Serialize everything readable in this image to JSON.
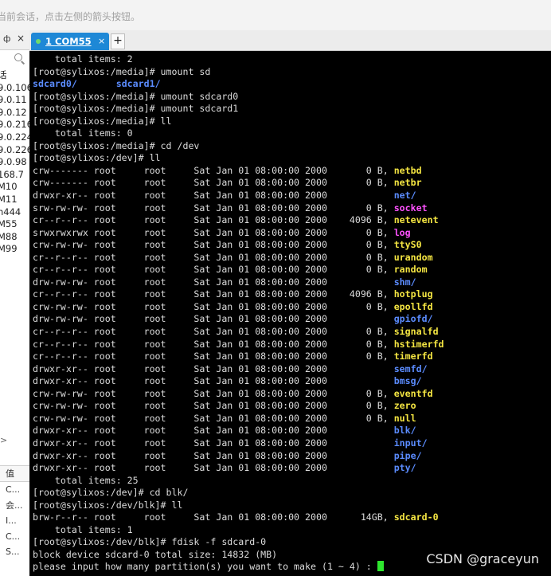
{
  "hint_bar": {
    "text": "当前会话，点击左侧的箭头按钮。"
  },
  "session_panel": {
    "pin_label": "ф",
    "close_label": "×",
    "items": [
      "话",
      "9.0.106",
      "9.0.11",
      "9.0.12",
      "9.0.216",
      "9.0.224",
      "9.0.226",
      "9.0.98",
      "168.7",
      "M10",
      "M11",
      "n444",
      "M55",
      "M88",
      "M99"
    ],
    "arrow_label": ">",
    "bottom_header": "值",
    "bottom_items": [
      "C...",
      "会...",
      "I...",
      "C...",
      "S..."
    ]
  },
  "tab_bar": {
    "tab_label": "1 COM55",
    "tab_close": "×",
    "new_tab": "+"
  },
  "terminal": {
    "cursor_color": "#2ee62e",
    "lines": [
      [
        {
          "t": "    total items: 2"
        }
      ],
      [
        {
          "t": "[root@sylixos:/media]# umount sd"
        }
      ],
      [
        {
          "t": "sdcard0/",
          "c": "b"
        },
        {
          "t": "       "
        },
        {
          "t": "sdcard1/",
          "c": "b"
        }
      ],
      [
        {
          "t": "[root@sylixos:/media]# umount sdcard0"
        }
      ],
      [
        {
          "t": "[root@sylixos:/media]# umount sdcard1"
        }
      ],
      [
        {
          "t": "[root@sylixos:/media]# ll"
        }
      ],
      [
        {
          "t": "    total items: 0"
        }
      ],
      [
        {
          "t": "[root@sylixos:/media]# cd /dev"
        }
      ],
      [
        {
          "t": "[root@sylixos:/dev]# ll"
        }
      ],
      [
        {
          "t": "crw------- root     root     Sat Jan 01 08:00:00 2000       0 B, "
        },
        {
          "t": "netbd",
          "c": "y"
        }
      ],
      [
        {
          "t": "crw------- root     root     Sat Jan 01 08:00:00 2000       0 B, "
        },
        {
          "t": "netbr",
          "c": "y"
        }
      ],
      [
        {
          "t": "drwxr-xr-- root     root     Sat Jan 01 08:00:00 2000            "
        },
        {
          "t": "net/",
          "c": "b"
        }
      ],
      [
        {
          "t": "srw-rw-rw- root     root     Sat Jan 01 08:00:00 2000       0 B, "
        },
        {
          "t": "socket",
          "c": "m"
        }
      ],
      [
        {
          "t": "cr--r--r-- root     root     Sat Jan 01 08:00:00 2000    4096 B, "
        },
        {
          "t": "netevent",
          "c": "y"
        }
      ],
      [
        {
          "t": "srwxrwxrwx root     root     Sat Jan 01 08:00:00 2000       0 B, "
        },
        {
          "t": "log",
          "c": "m"
        }
      ],
      [
        {
          "t": "crw-rw-rw- root     root     Sat Jan 01 08:00:00 2000       0 B, "
        },
        {
          "t": "ttyS0",
          "c": "y"
        }
      ],
      [
        {
          "t": "cr--r--r-- root     root     Sat Jan 01 08:00:00 2000       0 B, "
        },
        {
          "t": "urandom",
          "c": "y"
        }
      ],
      [
        {
          "t": "cr--r--r-- root     root     Sat Jan 01 08:00:00 2000       0 B, "
        },
        {
          "t": "random",
          "c": "y"
        }
      ],
      [
        {
          "t": "drw-rw-rw- root     root     Sat Jan 01 08:00:00 2000            "
        },
        {
          "t": "shm/",
          "c": "b"
        }
      ],
      [
        {
          "t": "cr--r--r-- root     root     Sat Jan 01 08:00:00 2000    4096 B, "
        },
        {
          "t": "hotplug",
          "c": "y"
        }
      ],
      [
        {
          "t": "crw-rw-rw- root     root     Sat Jan 01 08:00:00 2000       0 B, "
        },
        {
          "t": "epollfd",
          "c": "y"
        }
      ],
      [
        {
          "t": "drw-rw-rw- root     root     Sat Jan 01 08:00:00 2000            "
        },
        {
          "t": "gpiofd/",
          "c": "b"
        }
      ],
      [
        {
          "t": "cr--r--r-- root     root     Sat Jan 01 08:00:00 2000       0 B, "
        },
        {
          "t": "signalfd",
          "c": "y"
        }
      ],
      [
        {
          "t": "cr--r--r-- root     root     Sat Jan 01 08:00:00 2000       0 B, "
        },
        {
          "t": "hstimerfd",
          "c": "y"
        }
      ],
      [
        {
          "t": "cr--r--r-- root     root     Sat Jan 01 08:00:00 2000       0 B, "
        },
        {
          "t": "timerfd",
          "c": "y"
        }
      ],
      [
        {
          "t": "drwxr-xr-- root     root     Sat Jan 01 08:00:00 2000            "
        },
        {
          "t": "semfd/",
          "c": "b"
        }
      ],
      [
        {
          "t": "drwxr-xr-- root     root     Sat Jan 01 08:00:00 2000            "
        },
        {
          "t": "bmsg/",
          "c": "b"
        }
      ],
      [
        {
          "t": "crw-rw-rw- root     root     Sat Jan 01 08:00:00 2000       0 B, "
        },
        {
          "t": "eventfd",
          "c": "y"
        }
      ],
      [
        {
          "t": "crw-rw-rw- root     root     Sat Jan 01 08:00:00 2000       0 B, "
        },
        {
          "t": "zero",
          "c": "y"
        }
      ],
      [
        {
          "t": "crw-rw-rw- root     root     Sat Jan 01 08:00:00 2000       0 B, "
        },
        {
          "t": "null",
          "c": "y"
        }
      ],
      [
        {
          "t": "drwxr-xr-- root     root     Sat Jan 01 08:00:00 2000            "
        },
        {
          "t": "blk/",
          "c": "b"
        }
      ],
      [
        {
          "t": "drwxr-xr-- root     root     Sat Jan 01 08:00:00 2000            "
        },
        {
          "t": "input/",
          "c": "b"
        }
      ],
      [
        {
          "t": "drwxr-xr-- root     root     Sat Jan 01 08:00:00 2000            "
        },
        {
          "t": "pipe/",
          "c": "b"
        }
      ],
      [
        {
          "t": "drwxr-xr-- root     root     Sat Jan 01 08:00:00 2000            "
        },
        {
          "t": "pty/",
          "c": "b"
        }
      ],
      [
        {
          "t": "    total items: 25"
        }
      ],
      [
        {
          "t": "[root@sylixos:/dev]# cd blk/"
        }
      ],
      [
        {
          "t": "[root@sylixos:/dev/blk]# ll"
        }
      ],
      [
        {
          "t": "brw-r--r-- root     root     Sat Jan 01 08:00:00 2000      14GB, "
        },
        {
          "t": "sdcard-0",
          "c": "y"
        }
      ],
      [
        {
          "t": "    total items: 1"
        }
      ],
      [
        {
          "t": "[root@sylixos:/dev/blk]# fdisk -f sdcard-0"
        }
      ],
      [
        {
          "t": "block device sdcard-0 total size: 14832 (MB)"
        }
      ],
      [
        {
          "t": "please input how many partition(s) you want to make (1 ~ 4) : "
        },
        {
          "t": "",
          "c": "cursor"
        }
      ]
    ]
  },
  "watermark": {
    "text": "CSDN @graceyun"
  }
}
